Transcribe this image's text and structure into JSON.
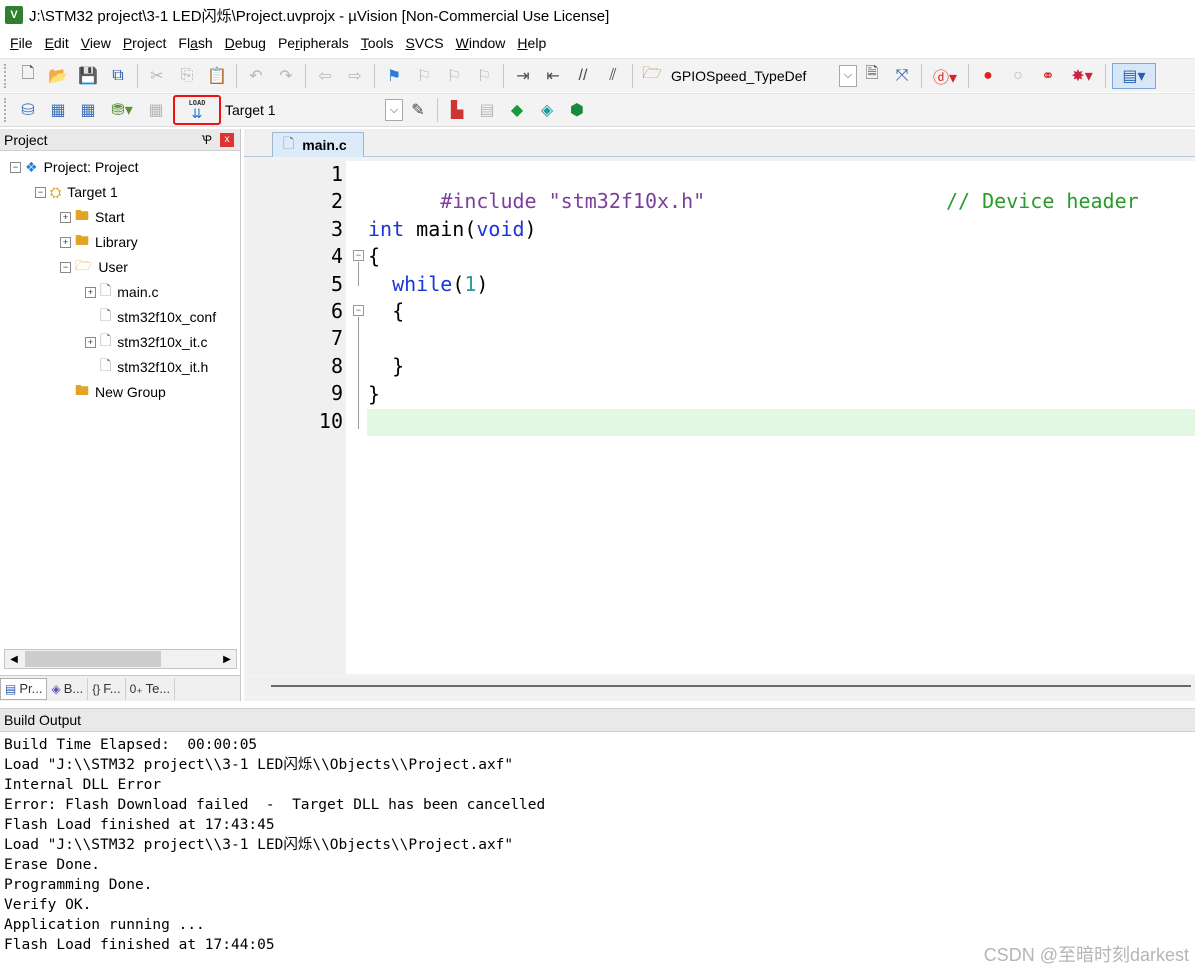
{
  "window": {
    "title": "J:\\STM32 project\\3-1 LED闪烁\\Project.uvprojx - µVision  [Non-Commercial Use License]",
    "logo": "V"
  },
  "menu": [
    {
      "label": "File",
      "accel": "F",
      "rest": "ile"
    },
    {
      "label": "Edit",
      "accel": "E",
      "rest": "dit"
    },
    {
      "label": "View",
      "accel": "V",
      "rest": "iew"
    },
    {
      "label": "Project",
      "accel": "P",
      "rest": "roject"
    },
    {
      "label": "Flash",
      "pre": "Fl",
      "accel": "a",
      "rest": "sh"
    },
    {
      "label": "Debug",
      "accel": "D",
      "rest": "ebug"
    },
    {
      "label": "Peripherals",
      "pre": "Pe",
      "accel": "r",
      "rest": "ipherals"
    },
    {
      "label": "Tools",
      "accel": "T",
      "rest": "ools"
    },
    {
      "label": "SVCS",
      "accel": "S",
      "rest": "VCS"
    },
    {
      "label": "Window",
      "accel": "W",
      "rest": "indow"
    },
    {
      "label": "Help",
      "accel": "H",
      "rest": "elp"
    }
  ],
  "toolbar1": {
    "find_combo_value": "GPIOSpeed_TypeDef",
    "icons": [
      "new-file-icon",
      "open-file-icon",
      "save-icon",
      "save-all-icon",
      "cut-icon",
      "copy-icon",
      "paste-icon",
      "undo-icon",
      "redo-icon",
      "navigate-back-icon",
      "navigate-forward-icon",
      "bookmark-insert-icon",
      "bookmark-prev-icon",
      "bookmark-next-icon",
      "bookmark-clear-icon",
      "indent-icon",
      "unindent-icon",
      "comment-icon",
      "uncomment-icon",
      "find-in-files-icon",
      "incremental-find-icon",
      "source-browser-icon",
      "debug-session-icon",
      "breakpoint-insert-icon",
      "breakpoint-disable-icon",
      "breakpoint-disable-all-icon",
      "breakpoint-kill-all-icon",
      "window-layout-icon"
    ]
  },
  "toolbar2": {
    "target_combo_value": "Target 1",
    "load_label": "LOAD",
    "icons": [
      "translate-icon",
      "build-icon",
      "rebuild-icon",
      "batch-build-icon",
      "stop-build-icon",
      "target-options-icon",
      "manage-components-icon",
      "select-packs-icon",
      "pack-installer-icon",
      "select-software-packs-icon",
      "run-time-env-icon"
    ]
  },
  "project_panel": {
    "title": "Project",
    "pin_glyph": "Ꝕ",
    "close_glyph": "x",
    "tree": [
      {
        "label": "Project: Project",
        "level": 0,
        "expander": "−",
        "icon": "project"
      },
      {
        "label": "Target 1",
        "level": 1,
        "expander": "−",
        "icon": "target"
      },
      {
        "label": "Start",
        "level": 2,
        "expander": "+",
        "icon": "folder"
      },
      {
        "label": "Library",
        "level": 2,
        "expander": "+",
        "icon": "folder"
      },
      {
        "label": "User",
        "level": 2,
        "expander": "−",
        "icon": "folder-open"
      },
      {
        "label": "main.c",
        "level": 3,
        "expander": "+",
        "icon": "file"
      },
      {
        "label": "stm32f10x_conf",
        "level": 3,
        "expander": "",
        "icon": "file"
      },
      {
        "label": "stm32f10x_it.c",
        "level": 3,
        "expander": "+",
        "icon": "file"
      },
      {
        "label": "stm32f10x_it.h",
        "level": 3,
        "expander": "",
        "icon": "file"
      },
      {
        "label": "New Group",
        "level": 2,
        "expander": "",
        "icon": "folder"
      }
    ],
    "tabs": [
      {
        "label": "Pr...",
        "icon": "project-tab-icon",
        "glyph": "▤"
      },
      {
        "label": "B...",
        "icon": "books-tab-icon",
        "glyph": "◈"
      },
      {
        "label": "F...",
        "icon": "functions-tab-icon",
        "glyph": "{}"
      },
      {
        "label": "Te...",
        "icon": "templates-tab-icon",
        "glyph": "0₊"
      }
    ]
  },
  "editor": {
    "tab_label": "main.c",
    "lines": [
      {
        "n": "1"
      },
      {
        "n": "2"
      },
      {
        "n": "3"
      },
      {
        "n": "4"
      },
      {
        "n": "5"
      },
      {
        "n": "6"
      },
      {
        "n": "7"
      },
      {
        "n": "8"
      },
      {
        "n": "9"
      },
      {
        "n": "10"
      }
    ],
    "code": {
      "l1_directive": "#include",
      "l1_string": "\"stm32f10x.h\"",
      "l1_comment": "// Device header",
      "l3_type": "int",
      "l3_name": " main(",
      "l3_param": "void",
      "l3_close": ")",
      "l4": "{",
      "l5_kw": "while",
      "l5_open": "(",
      "l5_num": "1",
      "l5_close": ")",
      "l6": "{",
      "l8": "}",
      "l9": "}"
    }
  },
  "build_output": {
    "title": "Build Output",
    "lines": [
      "Build Time Elapsed:  00:00:05",
      "Load \"J:\\\\STM32 project\\\\3-1 LED闪烁\\\\Objects\\\\Project.axf\"",
      "Internal DLL Error",
      "Error: Flash Download failed  -  Target DLL has been cancelled",
      "Flash Load finished at 17:43:45",
      "Load \"J:\\\\STM32 project\\\\3-1 LED闪烁\\\\Objects\\\\Project.axf\"",
      "Erase Done.",
      "Programming Done.",
      "Verify OK.",
      "Application running ...",
      "Flash Load finished at 17:44:05"
    ]
  },
  "watermark": "CSDN @至暗时刻darkest",
  "colors": {
    "preprocessor": "#7b3f9a",
    "keyword": "#1a36d6",
    "comment": "#2a9a2a",
    "number": "#2a9a9a",
    "current_line": "#e3f8e3",
    "load_highlight": "#e11111"
  }
}
